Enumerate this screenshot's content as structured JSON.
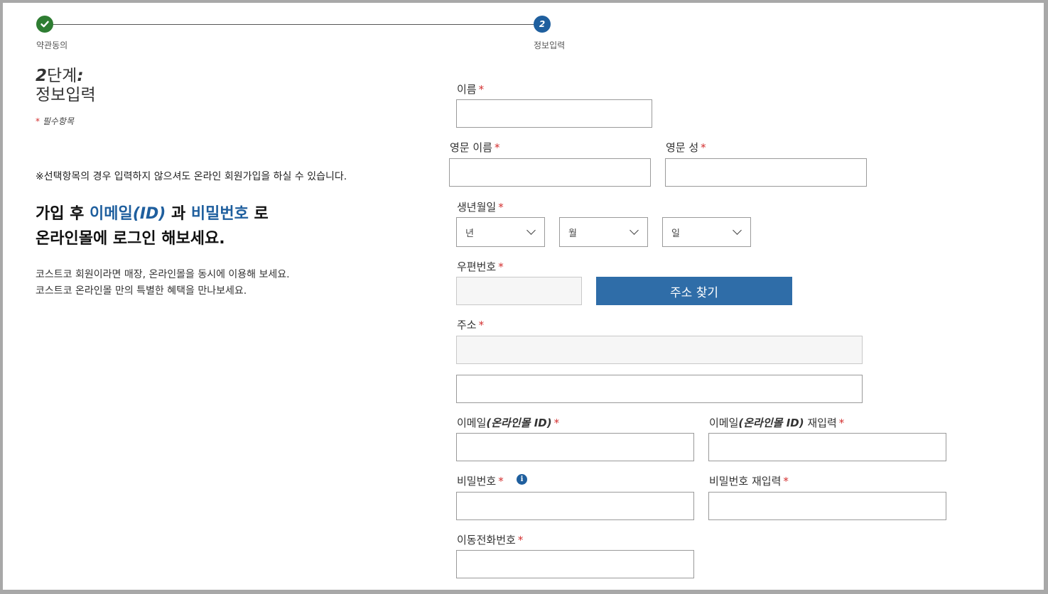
{
  "stepper": {
    "step1": {
      "label": "약관동의",
      "icon": "check-icon"
    },
    "step2": {
      "number": "2",
      "label": "정보입력"
    }
  },
  "left": {
    "title_num": "2",
    "title_word": "단계",
    "title_colon": ":",
    "title_sub": "정보입력",
    "required_star": "*",
    "required_text": "필수항목",
    "optional_note": "※선택항목의 경우 입력하지 않으셔도 온라인 회원가입을 하실 수 있습니다.",
    "promo_1": "가입 후 ",
    "promo_email": "이메일",
    "promo_id": "(ID)",
    "promo_2": " 과 ",
    "promo_password": "비밀번호",
    "promo_3": " 로",
    "promo_4": "온라인몰에 로그인 해보세요.",
    "desc_1": "코스트코 회원이라면 매장, 온라인몰을 동시에 이용해 보세요.",
    "desc_2": "코스트코 온라인몰 만의 특별한 혜택을 만나보세요."
  },
  "form": {
    "star": "*",
    "name_label": "이름",
    "eng_first_label": "영문 이름",
    "eng_last_label": "영문 성",
    "birth_label": "생년월일",
    "birth_year": "년",
    "birth_month": "월",
    "birth_day": "일",
    "zip_label": "우편번호",
    "address_button": "주소 찾기",
    "address_label": "주소",
    "email_label_pre": "이메일",
    "email_label_mid": "(온라인몰 ",
    "email_label_id": "ID)",
    "email_confirm_suffix": " 재입력",
    "password_label": "비밀번호",
    "password_confirm_label": "비밀번호 재입력",
    "phone_label": "이동전화번호",
    "info_glyph": "i"
  },
  "colors": {
    "accent": "#1f5f9e",
    "button": "#2f6da8",
    "success": "#2e7d32",
    "required": "#d32f2f"
  }
}
